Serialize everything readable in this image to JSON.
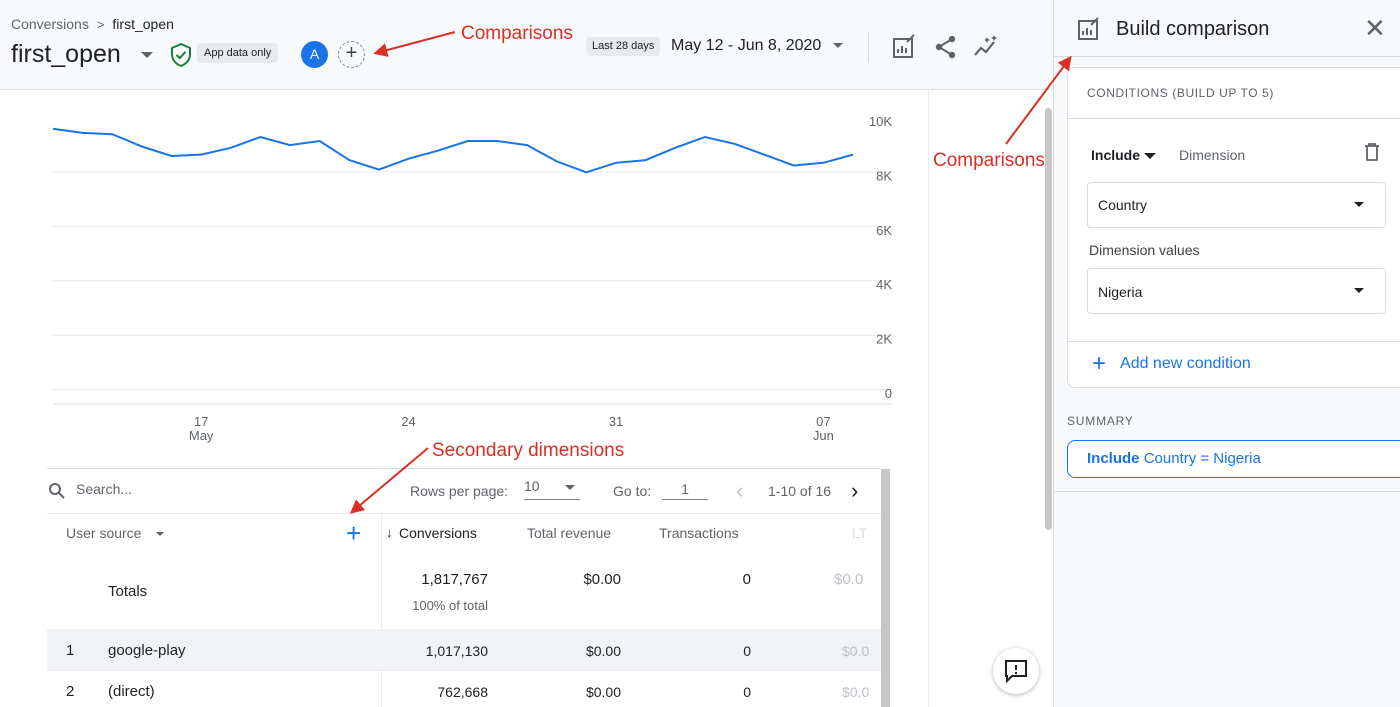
{
  "header": {
    "breadcrumb": [
      "Conversions",
      "first_open"
    ],
    "title": "first_open",
    "platform_chip": "App data only",
    "comparison_avatar": "A",
    "range_chip": "Last 28 days",
    "date_range": "May 12 - Jun 8, 2020"
  },
  "chart_data": {
    "type": "line",
    "title": "",
    "y_ticks": [
      "10K",
      "8K",
      "6K",
      "4K",
      "2K",
      "0"
    ],
    "x_ticks": [
      {
        "day": "17",
        "month": "May"
      },
      {
        "day": "24",
        "month": ""
      },
      {
        "day": "31",
        "month": ""
      },
      {
        "day": "07",
        "month": "Jun"
      }
    ],
    "ylim": [
      0,
      10000
    ],
    "grid": true,
    "series": [
      {
        "color": "#1a73e8",
        "x": [
          "May 12",
          "May 13",
          "May 14",
          "May 15",
          "May 16",
          "May 17",
          "May 18",
          "May 19",
          "May 20",
          "May 21",
          "May 22",
          "May 23",
          "May 24",
          "May 25",
          "May 26",
          "May 27",
          "May 28",
          "May 29",
          "May 30",
          "May 31",
          "Jun 1",
          "Jun 2",
          "Jun 3",
          "Jun 4",
          "Jun 5",
          "Jun 6",
          "Jun 7",
          "Jun 8"
        ],
        "values": [
          9750,
          9600,
          9550,
          9100,
          8750,
          8800,
          9050,
          9450,
          9150,
          9300,
          8600,
          8250,
          8650,
          8950,
          9300,
          9300,
          9150,
          8550,
          8150,
          8500,
          8600,
          9050,
          9450,
          9200,
          8800,
          8400,
          8500,
          8800
        ]
      }
    ]
  },
  "table": {
    "search_placeholder": "Search...",
    "rows_per_page_label": "Rows per page:",
    "rows_per_page": "10",
    "goto_label": "Go to:",
    "goto_value": "1",
    "page_info": "1-10 of 16",
    "dimension_header": "User source",
    "columns": [
      "Conversions",
      "Total revenue",
      "Transactions",
      "LT"
    ],
    "totals": {
      "label": "Totals",
      "conversions": "1,817,767",
      "conversions_sub": "100% of total",
      "revenue": "$0.00",
      "transactions": "0",
      "ltv": "$0.0"
    },
    "rows": [
      {
        "index": "1",
        "source": "google-play",
        "conversions": "1,017,130",
        "revenue": "$0.00",
        "transactions": "0",
        "ltv": "$0.0"
      },
      {
        "index": "2",
        "source": "(direct)",
        "conversions": "762,668",
        "revenue": "$0.00",
        "transactions": "0",
        "ltv": "$0.0"
      }
    ]
  },
  "panel": {
    "title": "Build comparison",
    "conditions_title": "CONDITIONS (BUILD UP TO 5)",
    "include_label": "Include",
    "dimension_label": "Dimension",
    "dimension_value": "Country",
    "dimension_values_label": "Dimension values",
    "dimension_values_value": "Nigeria",
    "add_condition": "Add new condition",
    "summary_label": "SUMMARY",
    "summary_include": "Include",
    "summary_text": "Country = Nigeria"
  },
  "annotations": {
    "comparisons_top": "Comparisons",
    "comparisons_panel": "Comparisons",
    "secondary_dimensions": "Secondary dimensions",
    "color": "#d93025"
  },
  "icons": [
    "chevron-right-icon",
    "shield-check-icon",
    "add-comparison-icon",
    "customize-report-icon",
    "share-icon",
    "insights-icon",
    "search-icon",
    "edit-comparison-icon",
    "close-icon",
    "trash-icon",
    "feedback-icon",
    "plus-icon"
  ]
}
